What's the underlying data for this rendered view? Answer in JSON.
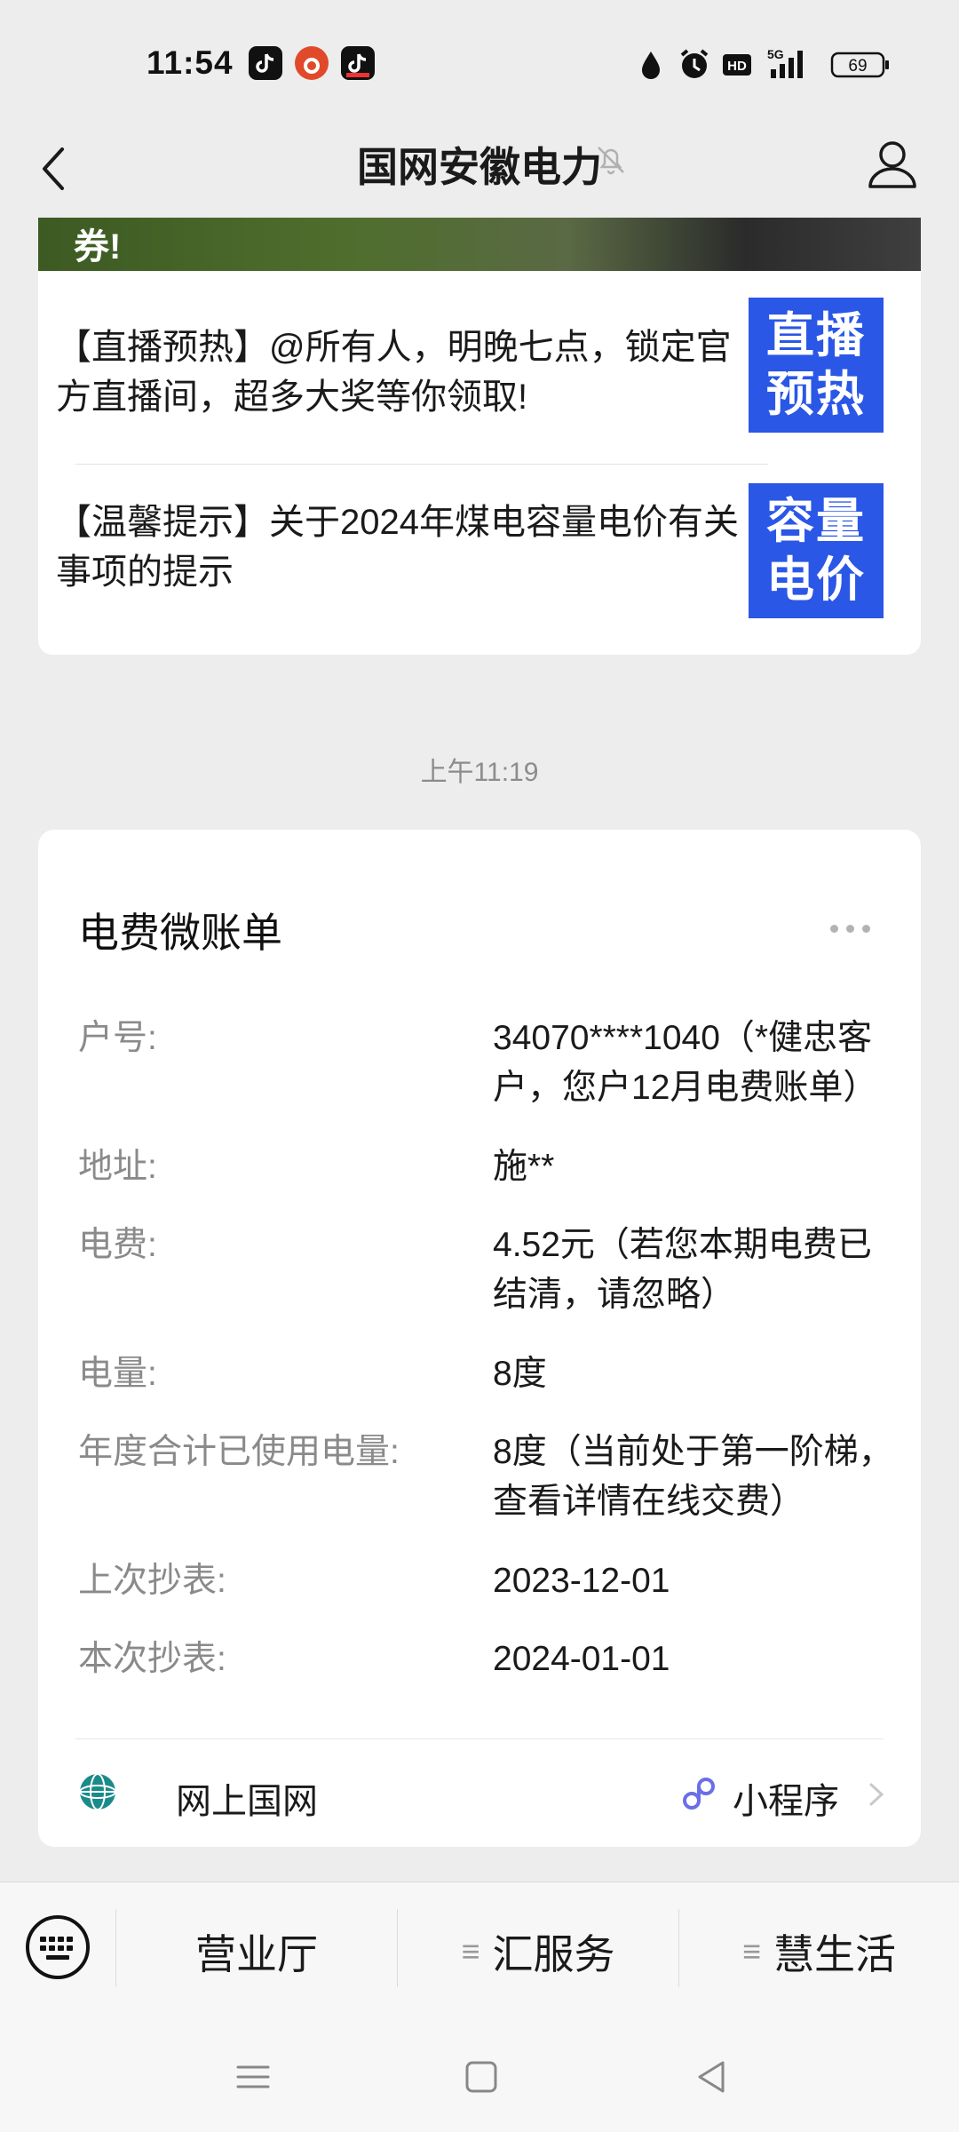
{
  "status_bar": {
    "time": "11:54",
    "battery": "69",
    "network": "5G",
    "hd": "HD"
  },
  "header": {
    "title": "国网安徽电力"
  },
  "articles": {
    "banner_text": "券!",
    "items": [
      {
        "text": "【直播预热】@所有人，明晚七点，锁定官方直播间，超多大奖等你领取!",
        "thumb_line1": "直播",
        "thumb_line2": "预热"
      },
      {
        "text": "【温馨提示】关于2024年煤电容量电价有关事项的提示",
        "thumb_line1": "容量",
        "thumb_line2": "电价"
      }
    ]
  },
  "timestamp": "上午11:19",
  "bill": {
    "title": "电费微账单",
    "rows": [
      {
        "label": "户号:",
        "value": "34070****1040（*健忠客户，您户12月电费账单）"
      },
      {
        "label": "地址:",
        "value": "施**"
      },
      {
        "label": "电费:",
        "value": "4.52元（若您本期电费已结清，请忽略）"
      },
      {
        "label": "电量:",
        "value": "8度"
      },
      {
        "label": "年度合计已使用电量:",
        "value": "8度（当前处于第一阶梯，查看详情在线交费）"
      },
      {
        "label": "上次抄表:",
        "value": "2023-12-01"
      },
      {
        "label": "本次抄表:",
        "value": "2024-01-01"
      }
    ],
    "footer_left": "网上国网",
    "footer_right": "小程序"
  },
  "bottom_menu": {
    "items": [
      {
        "label": "营业厅"
      },
      {
        "label": "汇服务"
      },
      {
        "label": "慧生活"
      }
    ]
  },
  "colors": {
    "background": "#ededed",
    "card": "#ffffff",
    "thumb_blue": "#2a57e6",
    "label_gray": "#8a8a8a"
  }
}
